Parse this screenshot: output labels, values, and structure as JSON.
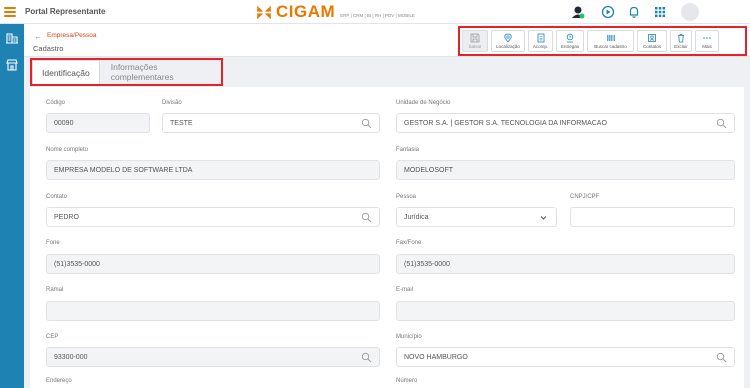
{
  "app": {
    "title": "Portal Representante",
    "logo_text": "CIGAM",
    "logo_sub": "ERP | CRM | BI | RH | PDV | MOBILE"
  },
  "header": {
    "breadcrumb": "Empresa/Pessoa",
    "page_title": "Cadastro"
  },
  "toolbar": [
    {
      "label": "Salvar",
      "icon": "save-icon",
      "disabled": true
    },
    {
      "label": "Localização",
      "icon": "map-pin-icon",
      "disabled": false
    },
    {
      "label": "Acomp.",
      "icon": "document-icon",
      "disabled": false
    },
    {
      "label": "Entregas",
      "icon": "delivery-icon",
      "disabled": false
    },
    {
      "label": "Buscar cadastro",
      "icon": "barcode-icon",
      "disabled": false
    },
    {
      "label": "Contatos",
      "icon": "contact-icon",
      "disabled": false
    },
    {
      "label": "Excluir",
      "icon": "trash-icon",
      "disabled": false
    },
    {
      "label": "Mais",
      "icon": "more-icon",
      "disabled": false
    }
  ],
  "tabs": {
    "identificacao": "Identificação",
    "complementares": "Informações complementares"
  },
  "form": {
    "codigo": {
      "label": "Código",
      "value": "00090"
    },
    "divisao": {
      "label": "Divisão",
      "value": "TESTE"
    },
    "unidade": {
      "label": "Unidade de Negócio",
      "value": "GESTOR S.A. | GESTOR S.A. TECNOLOGIA DA INFORMACAO"
    },
    "nome": {
      "label": "Nome completo",
      "value": "EMPRESA MODELO DE SOFTWARE LTDA"
    },
    "fantasia": {
      "label": "Fantasia",
      "value": "MODELOSOFT"
    },
    "contato": {
      "label": "Contato",
      "value": "PEDRO"
    },
    "pessoa": {
      "label": "Pessoa",
      "value": "Jurídica"
    },
    "cnpj": {
      "label": "CNPJ/CPF",
      "value": ""
    },
    "fone": {
      "label": "Fone",
      "value": "(51)3535-0000"
    },
    "fax": {
      "label": "Fax/Fone",
      "value": "(51)3535-0000"
    },
    "ramal": {
      "label": "Ramal",
      "value": ""
    },
    "email": {
      "label": "E-mail",
      "value": ""
    },
    "cep": {
      "label": "CEP",
      "value": "93300-000"
    },
    "municipio": {
      "label": "Município",
      "value": "NOVO HAMBURGO"
    },
    "endereco": {
      "label": "Endereço"
    },
    "numero": {
      "label": "Número"
    }
  },
  "colors": {
    "accent": "#e77800",
    "sidebar": "#1e83b3",
    "highlight": "#e3222a"
  }
}
